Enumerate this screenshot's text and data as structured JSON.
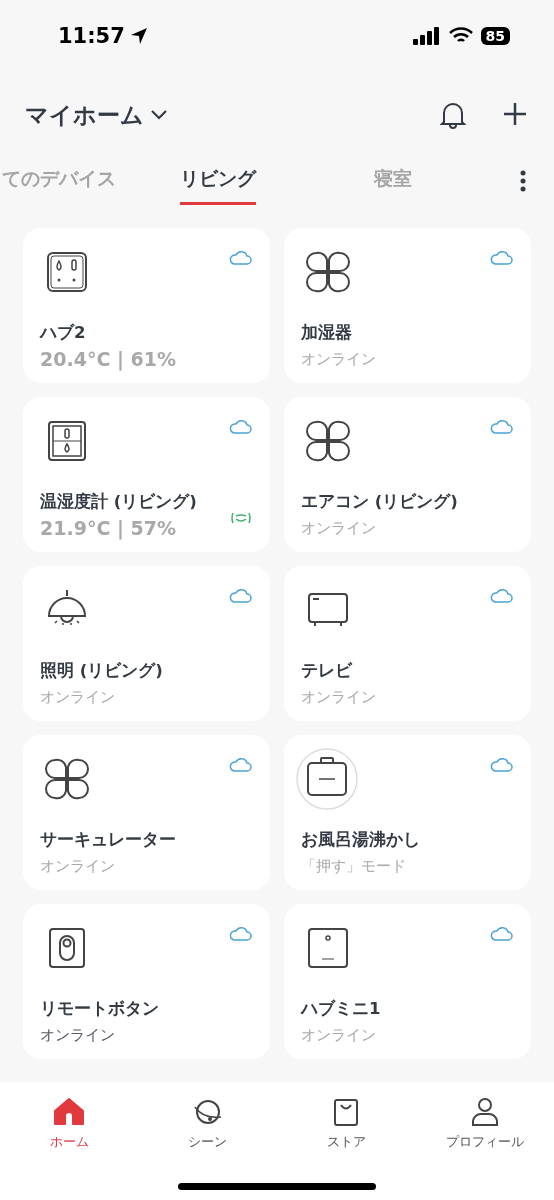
{
  "status_bar": {
    "time": "11:57",
    "battery": "85"
  },
  "header": {
    "title": "マイホーム"
  },
  "tabs": [
    {
      "label": "てのデバイス",
      "selected": false
    },
    {
      "label": "リビング",
      "selected": true
    },
    {
      "label": "寝室",
      "selected": false
    }
  ],
  "devices": [
    {
      "kind": "hub2",
      "name": "ハブ2",
      "detail": {
        "kind": "reading",
        "text": "20.4°C | 61%"
      },
      "ble_signal": false
    },
    {
      "kind": "clover",
      "name": "加湿器",
      "detail": {
        "kind": "status",
        "text": "オンライン"
      },
      "ble_signal": false
    },
    {
      "kind": "meter",
      "name": "温湿度計 (リビング)",
      "detail": {
        "kind": "reading",
        "text": "21.9°C | 57%"
      },
      "ble_signal": true
    },
    {
      "kind": "clover",
      "name": "エアコン (リビング)",
      "detail": {
        "kind": "status",
        "text": "オンライン"
      },
      "ble_signal": false
    },
    {
      "kind": "lamp",
      "name": "照明 (リビング)",
      "detail": {
        "kind": "status",
        "text": "オンライン"
      },
      "ble_signal": false
    },
    {
      "kind": "tv",
      "name": "テレビ",
      "detail": {
        "kind": "status",
        "text": "オンライン"
      },
      "ble_signal": false
    },
    {
      "kind": "clover",
      "name": "サーキュレーター",
      "detail": {
        "kind": "status",
        "text": "オンライン"
      },
      "ble_signal": false
    },
    {
      "kind": "bot",
      "name": "お風呂湯沸かし",
      "detail": {
        "kind": "status",
        "text": "「押す」モード"
      },
      "ble_signal": false
    },
    {
      "kind": "button",
      "name": "リモートボタン",
      "detail": {
        "kind": "strong",
        "text": "オンライン"
      },
      "ble_signal": false
    },
    {
      "kind": "hubmini",
      "name": "ハブミニ1",
      "detail": {
        "kind": "status",
        "text": "オンライン"
      },
      "ble_signal": false
    }
  ],
  "nav": [
    {
      "kind": "home",
      "label": "ホーム",
      "selected": true
    },
    {
      "kind": "scene",
      "label": "シーン",
      "selected": false
    },
    {
      "kind": "store",
      "label": "ストア",
      "selected": false
    },
    {
      "kind": "profile",
      "label": "プロフィール",
      "selected": false
    }
  ]
}
